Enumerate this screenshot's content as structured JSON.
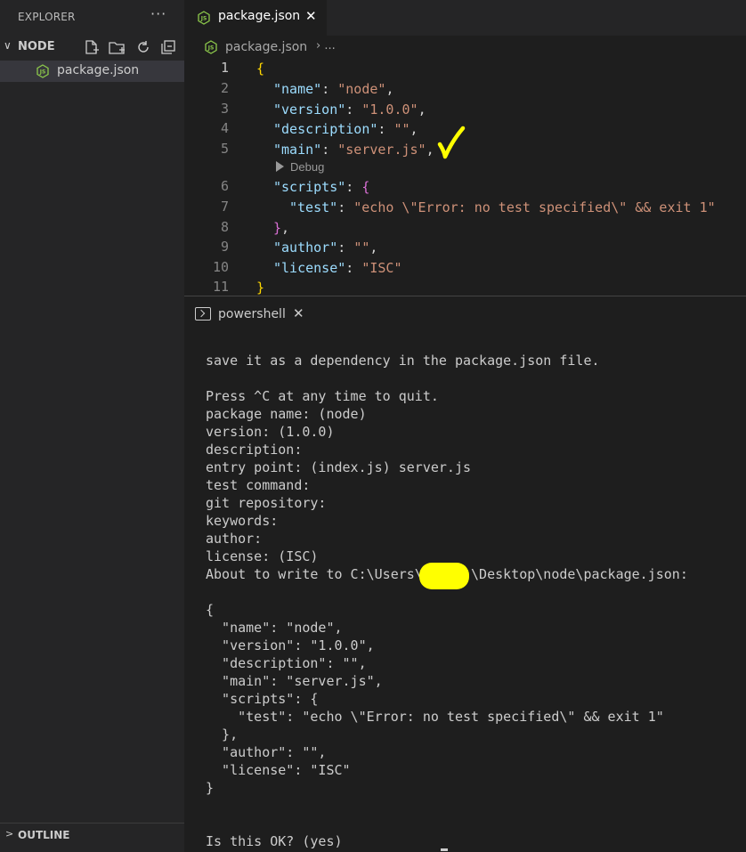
{
  "explorer": {
    "title": "EXPLORER",
    "more": "···",
    "folder": {
      "chevron": "∨",
      "name": "NODE",
      "actions": [
        "new-file-icon",
        "new-folder-icon",
        "refresh-icon",
        "collapse-all-icon"
      ]
    },
    "files": [
      {
        "name": "package.json",
        "icon": "nodejs-file-icon"
      }
    ],
    "outline": {
      "chevron": ">",
      "label": "OUTLINE"
    }
  },
  "editor": {
    "tab": {
      "label": "package.json",
      "close": "✕"
    },
    "breadcrumb": {
      "file": "package.json",
      "separator": "› ..."
    },
    "line_numbers": [
      "1",
      "2",
      "3",
      "4",
      "5",
      "6",
      "7",
      "8",
      "9",
      "10",
      "11"
    ],
    "codelens": "Debug",
    "lines": [
      {
        "open": "{"
      },
      {
        "key": "\"name\"",
        "colon": ": ",
        "value": "\"node\"",
        "tail": ","
      },
      {
        "key": "\"version\"",
        "colon": ": ",
        "value": "\"1.0.0\"",
        "tail": ","
      },
      {
        "key": "\"description\"",
        "colon": ": ",
        "value": "\"\"",
        "tail": ","
      },
      {
        "key": "\"main\"",
        "colon": ": ",
        "value": "\"server.js\"",
        "tail": ","
      },
      {
        "key": "\"scripts\"",
        "colon": ": ",
        "open": "{"
      },
      {
        "key": "\"test\"",
        "colon": ": ",
        "value": "\"echo \\\"Error: no test specified\\\" && exit 1\""
      },
      {
        "close": "}",
        "tail": ","
      },
      {
        "key": "\"author\"",
        "colon": ": ",
        "value": "\"\"",
        "tail": ","
      },
      {
        "key": "\"license\"",
        "colon": ": ",
        "value": "\"ISC\""
      },
      {
        "close": "}"
      }
    ]
  },
  "terminal": {
    "tab": {
      "label": "powershell",
      "close": "✕"
    },
    "lines": [
      "save it as a dependency in the package.json file.",
      "",
      "Press ^C at any time to quit.",
      "package name: (node)",
      "version: (1.0.0)",
      "description:",
      "entry point: (index.js) server.js",
      "test command:",
      "git repository:",
      "keywords:",
      "author:",
      "license: (ISC)",
      "About to write to C:\\Users\\      \\Desktop\\node\\package.json:",
      "",
      "{",
      "  \"name\": \"node\",",
      "  \"version\": \"1.0.0\",",
      "  \"description\": \"\",",
      "  \"main\": \"server.js\",",
      "  \"scripts\": {",
      "    \"test\": \"echo \\\"Error: no test specified\\\" && exit 1\"",
      "  },",
      "  \"author\": \"\",",
      "  \"license\": \"ISC\"",
      "}",
      "",
      "",
      "Is this OK? (yes)"
    ]
  },
  "colors": {
    "key": "#9cdcfe",
    "string": "#ce9178",
    "bracket_outer": "#ffd700",
    "bracket_inner": "#da70d6",
    "annotation": "#ffff00"
  }
}
